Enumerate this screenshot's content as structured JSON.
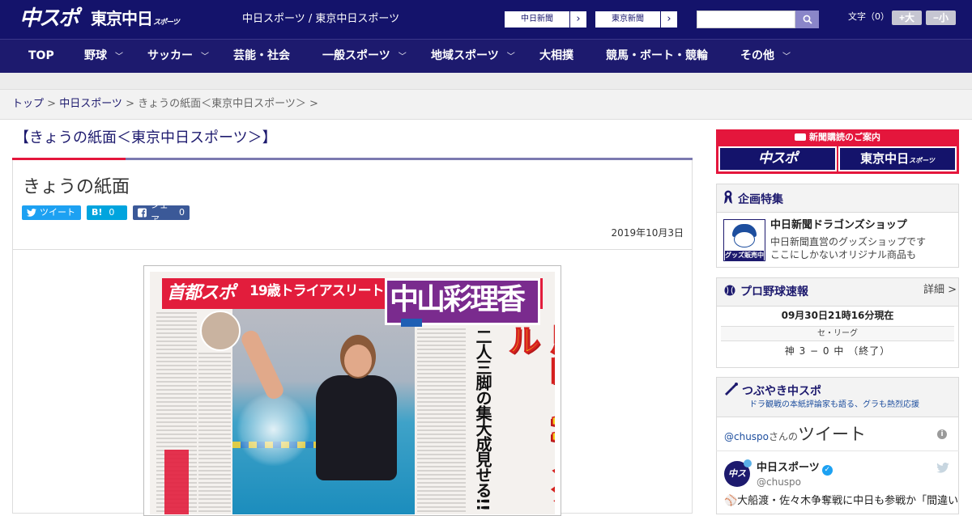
{
  "header": {
    "logo_chuspo": "中スポ",
    "logo_tokyo": "東京中日",
    "logo_tokyo_small": "スポーツ",
    "site_caption": "中日スポーツ / 東京中日スポーツ",
    "ext_links": [
      "中日新聞",
      "東京新聞"
    ],
    "search_placeholder": "",
    "font_size_label": "文字（0）",
    "font_bigger": "+大",
    "font_smaller": "−小"
  },
  "nav": {
    "items": [
      {
        "label": "TOP",
        "has_menu": false
      },
      {
        "label": "野球",
        "has_menu": true
      },
      {
        "label": "サッカー",
        "has_menu": true
      },
      {
        "label": "芸能・社会",
        "has_menu": false
      },
      {
        "label": "一般スポーツ",
        "has_menu": true
      },
      {
        "label": "地域スポーツ",
        "has_menu": true
      },
      {
        "label": "大相撲",
        "has_menu": false
      },
      {
        "label": "競馬・ボート・競輪",
        "has_menu": false
      },
      {
        "label": "その他",
        "has_menu": true
      }
    ]
  },
  "breadcrumb": {
    "items": [
      "トップ",
      "中日スポーツ",
      "きょうの紙面＜東京中日スポーツ＞"
    ],
    "separator": " > "
  },
  "main": {
    "page_heading": "【きょうの紙面＜東京中日スポーツ＞】",
    "article_title": "きょうの紙面",
    "share": {
      "tweet_label": "ツイート",
      "hatena_label": "B!",
      "hatena_count": "0",
      "facebook_label": "シェア",
      "facebook_count": "0"
    },
    "date": "2019年10月3日",
    "paper": {
      "masthead": "首都スポ",
      "age_text": "19歳トライアスリート",
      "name": "中山彩理香",
      "sub_headline": "二人三脚の集大成見せる!!",
      "main_headline": "恩師とWメダル"
    }
  },
  "sidebar": {
    "ad": {
      "title": "新聞購読のご案内",
      "logo_a": "中スポ",
      "logo_b": "東京中日",
      "logo_b_small": "スポーツ"
    },
    "features": {
      "title": "企画特集",
      "shop_thumb_label": "グッズ販売中",
      "shop_title": "中日新聞ドラゴンズショップ",
      "shop_desc_1": "中日新聞直営のグッズショップです",
      "shop_desc_2": "ここにしかないオリジナル商品も"
    },
    "baseball": {
      "title": "プロ野球速報",
      "detail_link": "詳細 >",
      "updated": "09月30日21時16分現在",
      "league": "セ・リーグ",
      "score_line": "神 3 − 0 中 （終了）"
    },
    "tweets": {
      "title": "つぶやき中スポ",
      "subtitle": "ドラ観戦の本紙評論家も語る、グラも熱烈応援",
      "account_link": "@chuspo",
      "account_suffix": "さんの",
      "header_big": "ツイート",
      "author_name": "中日スポーツ",
      "author_handle": "@chuspo",
      "avatar_text": "中スポ",
      "tweet_text": "⚾大船渡・佐々木争奪戦に中日も参戦か「間違い"
    }
  },
  "colors": {
    "header_bg": "#14136b",
    "nav_bg": "#1d1a6e",
    "accent_red": "#e4163c",
    "twitter_blue": "#1da1f2"
  },
  "icons": {
    "search": "search-icon",
    "chevron": "chevron-down-icon",
    "twitter": "twitter-icon",
    "facebook": "facebook-icon",
    "ribbon": "ribbon-icon",
    "baseball": "baseball-icon",
    "trumpet": "trumpet-icon",
    "info": "info-icon",
    "verified": "verified-icon"
  }
}
